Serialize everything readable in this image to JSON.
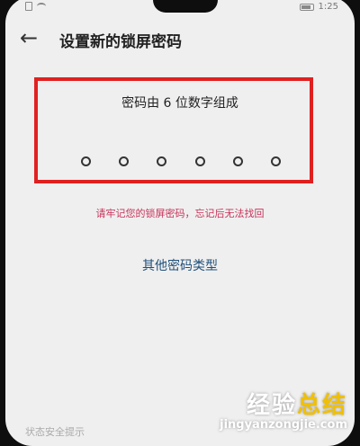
{
  "status_bar": {
    "time": "1:25"
  },
  "header": {
    "back_icon": "arrow-left-icon",
    "title": "设置新的锁屏密码"
  },
  "pin": {
    "instruction": "密码由 6 位数字组成",
    "digits": 6,
    "warning": "请牢记您的锁屏密码，忘记后无法找回"
  },
  "other_types": "其他密码类型",
  "bottom_text": "状态安全提示",
  "watermark": {
    "cn_main": "经验",
    "cn_accent": "总结",
    "url": "jingyanzongjie.com"
  },
  "colors": {
    "highlight_box": "#e02020",
    "warning": "#c8325a",
    "link": "#1f4f7a"
  }
}
